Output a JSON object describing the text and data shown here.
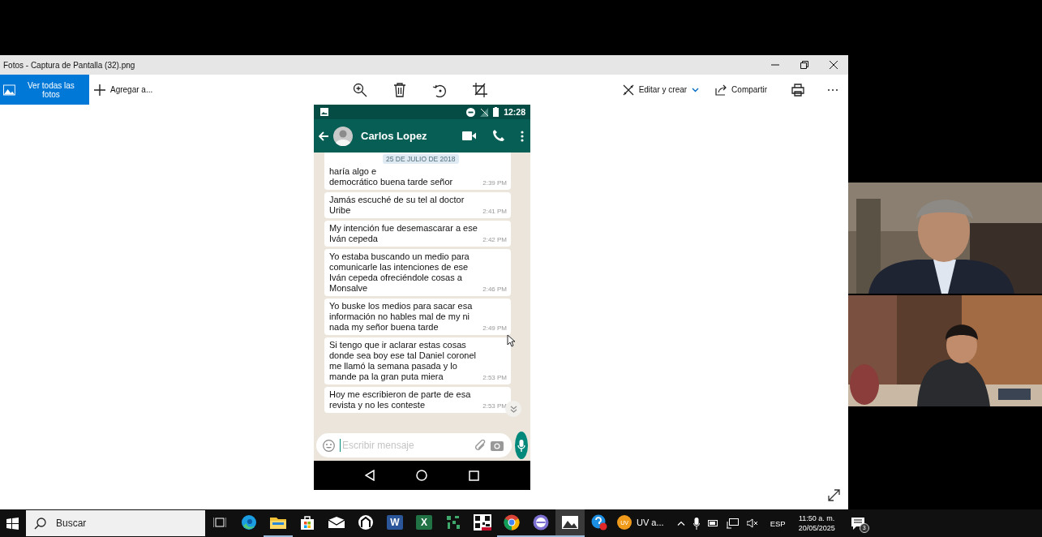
{
  "window": {
    "title": "Fotos - Captura de Pantalla (32).png"
  },
  "toolbar": {
    "view_all": "Ver todas las fotos",
    "add": "Agregar a...",
    "edit": "Editar y crear",
    "share": "Compartir"
  },
  "phone": {
    "status_time": "12:28",
    "contact": "Carlos Lopez",
    "date_chip": "25 DE JULIO DE 2018",
    "placeholder": "Escribir mensaje",
    "messages": [
      {
        "text": "haría algo e\ndemocrático buena tarde señor",
        "time": "2:39 PM"
      },
      {
        "text": "Jamás escuché de su tel al doctor Uribe",
        "time": "2:41 PM"
      },
      {
        "text": "My intención fue desemascarar  a ese Iván cepeda",
        "time": "2:42 PM"
      },
      {
        "text": "Yo estaba buscando un medio para comunicarle las intenciones de ese Iván cepeda ofreciéndole cosas a Monsalve",
        "time": "2:46 PM"
      },
      {
        "text": "Yo buske los medios para sacar esa información no hables mal de my ni nada my señor buena tarde",
        "time": "2:49 PM"
      },
      {
        "text": "Si tengo que ir aclarar estas cosas donde sea boy ese tal Daniel coronel me llamó la semana pasada y lo mande pa la gran puta miera",
        "time": "2:53 PM"
      },
      {
        "text": "Hoy me escribieron de parte de esa revista y no les conteste",
        "time": "2:53 PM"
      }
    ]
  },
  "taskbar": {
    "search_placeholder": "Buscar",
    "apps": [
      {
        "kind": "edge",
        "open": false,
        "selected": false
      },
      {
        "kind": "folder",
        "open": true,
        "selected": false
      },
      {
        "kind": "store",
        "open": false,
        "selected": false
      },
      {
        "kind": "mail",
        "open": false,
        "selected": false
      },
      {
        "kind": "ring",
        "open": false,
        "selected": false
      },
      {
        "kind": "word",
        "glyph": "W",
        "open": false,
        "selected": false
      },
      {
        "kind": "excel",
        "glyph": "X",
        "open": false,
        "selected": false
      },
      {
        "kind": "grid",
        "open": false,
        "selected": false
      },
      {
        "kind": "qr",
        "open": false,
        "selected": false
      },
      {
        "kind": "chrome",
        "open": true,
        "selected": false
      },
      {
        "kind": "disc",
        "open": true,
        "selected": false
      },
      {
        "kind": "photos",
        "open": true,
        "selected": true
      },
      {
        "kind": "help",
        "open": false,
        "selected": false
      },
      {
        "kind": "badge",
        "glyph": "UV",
        "label": "UV a...",
        "open": false,
        "selected": false
      }
    ],
    "language": "ESP",
    "time": "11:50 a. m.",
    "date": "20/05/2025",
    "notifications": "3"
  }
}
